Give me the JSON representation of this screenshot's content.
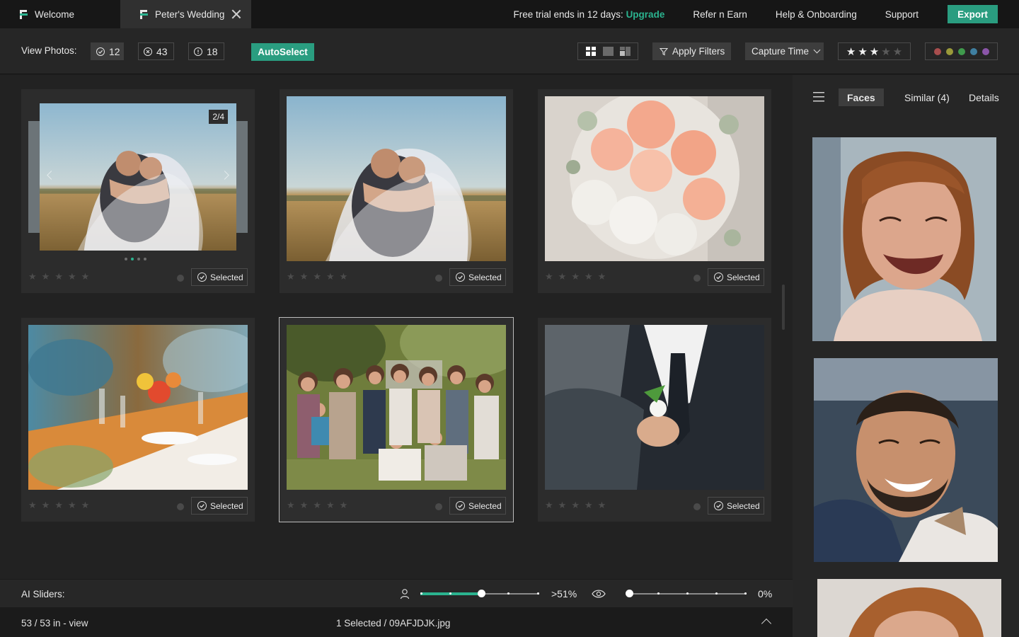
{
  "tabs": [
    {
      "label": "Welcome"
    },
    {
      "label": "Peter's Wedding"
    }
  ],
  "header": {
    "trial_text": "Free trial ends in 12 days:",
    "upgrade_label": "Upgrade",
    "links": [
      "Refer n Earn",
      "Help & Onboarding",
      "Support"
    ],
    "export_label": "Export"
  },
  "toolbar": {
    "view_label": "View Photos:",
    "counts": {
      "selected": "12",
      "rejected": "43",
      "flagged": "18"
    },
    "autoselect_label": "AutoSelect",
    "apply_filters_label": "Apply Filters",
    "sort_label": "Capture Time",
    "star_filter": {
      "rating": 3,
      "max": 5
    },
    "color_labels": [
      "#a84e4e",
      "#9a9a3a",
      "#3f9a4c",
      "#3f7fa0",
      "#8a55a8"
    ]
  },
  "cards": [
    {
      "badge": "2/4",
      "stack_dots": 4,
      "active_dot": 1,
      "status": "Selected"
    },
    {
      "status": "Selected"
    },
    {
      "status": "Selected"
    },
    {
      "status": "Selected"
    },
    {
      "status": "Selected"
    },
    {
      "status": "Selected"
    }
  ],
  "ai_sliders": {
    "label": "AI Sliders:",
    "faces": {
      "percent_label": ">51%",
      "value": 0.51
    },
    "eye": {
      "percent_label": "0%",
      "value": 0.0
    }
  },
  "status": {
    "count_text": "53 / 53 in - view",
    "selection_text": "1 Selected / 09AFJDJK.jpg"
  },
  "right_panel": {
    "tabs": [
      "Faces",
      "Similar (4)",
      "Details"
    ]
  }
}
